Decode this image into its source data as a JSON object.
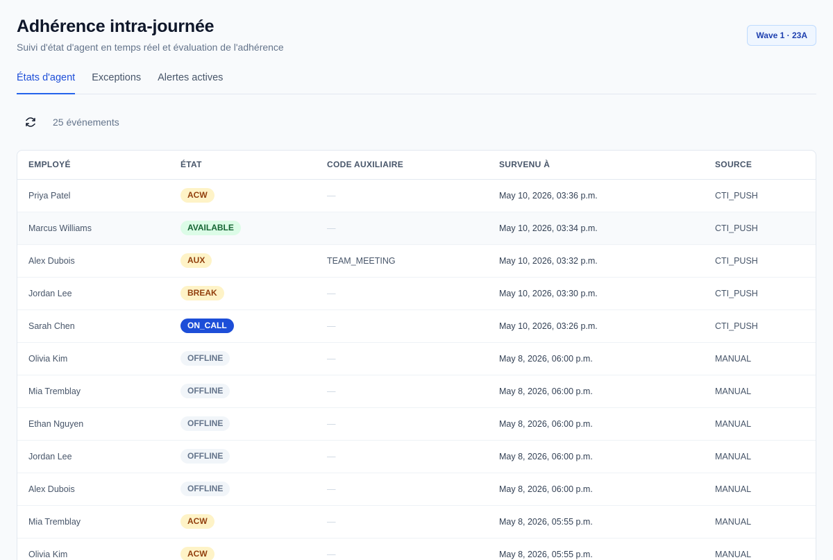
{
  "header": {
    "title": "Adhérence intra-journée",
    "subtitle": "Suivi d'état d'agent en temps réel et évaluation de l'adhérence",
    "badge": "Wave 1 · 23A"
  },
  "tabs": [
    {
      "label": "États d'agent",
      "active": true
    },
    {
      "label": "Exceptions",
      "active": false
    },
    {
      "label": "Alertes actives",
      "active": false
    }
  ],
  "toolbar": {
    "refresh_icon": "refresh-icon",
    "count_label": "25 événements"
  },
  "table": {
    "columns": [
      "EMPLOYÉ",
      "ÉTAT",
      "CODE AUXILIAIRE",
      "SURVENU À",
      "SOURCE"
    ],
    "rows": [
      {
        "employee": "Priya Patel",
        "state": "ACW",
        "aux": "—",
        "time": "May 10, 2026, 03:36 p.m.",
        "source": "CTI_PUSH"
      },
      {
        "employee": "Marcus Williams",
        "state": "AVAILABLE",
        "aux": "—",
        "time": "May 10, 2026, 03:34 p.m.",
        "source": "CTI_PUSH"
      },
      {
        "employee": "Alex Dubois",
        "state": "AUX",
        "aux": "TEAM_MEETING",
        "time": "May 10, 2026, 03:32 p.m.",
        "source": "CTI_PUSH"
      },
      {
        "employee": "Jordan Lee",
        "state": "BREAK",
        "aux": "—",
        "time": "May 10, 2026, 03:30 p.m.",
        "source": "CTI_PUSH"
      },
      {
        "employee": "Sarah Chen",
        "state": "ON_CALL",
        "aux": "—",
        "time": "May 10, 2026, 03:26 p.m.",
        "source": "CTI_PUSH"
      },
      {
        "employee": "Olivia Kim",
        "state": "OFFLINE",
        "aux": "—",
        "time": "May 8, 2026, 06:00 p.m.",
        "source": "MANUAL"
      },
      {
        "employee": "Mia Tremblay",
        "state": "OFFLINE",
        "aux": "—",
        "time": "May 8, 2026, 06:00 p.m.",
        "source": "MANUAL"
      },
      {
        "employee": "Ethan Nguyen",
        "state": "OFFLINE",
        "aux": "—",
        "time": "May 8, 2026, 06:00 p.m.",
        "source": "MANUAL"
      },
      {
        "employee": "Jordan Lee",
        "state": "OFFLINE",
        "aux": "—",
        "time": "May 8, 2026, 06:00 p.m.",
        "source": "MANUAL"
      },
      {
        "employee": "Alex Dubois",
        "state": "OFFLINE",
        "aux": "—",
        "time": "May 8, 2026, 06:00 p.m.",
        "source": "MANUAL"
      },
      {
        "employee": "Mia Tremblay",
        "state": "ACW",
        "aux": "—",
        "time": "May 8, 2026, 05:55 p.m.",
        "source": "MANUAL"
      },
      {
        "employee": "Olivia Kim",
        "state": "ACW",
        "aux": "—",
        "time": "May 8, 2026, 05:55 p.m.",
        "source": "MANUAL"
      }
    ]
  },
  "colors": {
    "accent": "#2563eb",
    "pill_warning_bg": "#fef3c7",
    "pill_success_bg": "#dcfce7",
    "pill_on_call_bg": "#1d4ed8",
    "pill_offline_bg": "#f1f5f9"
  }
}
